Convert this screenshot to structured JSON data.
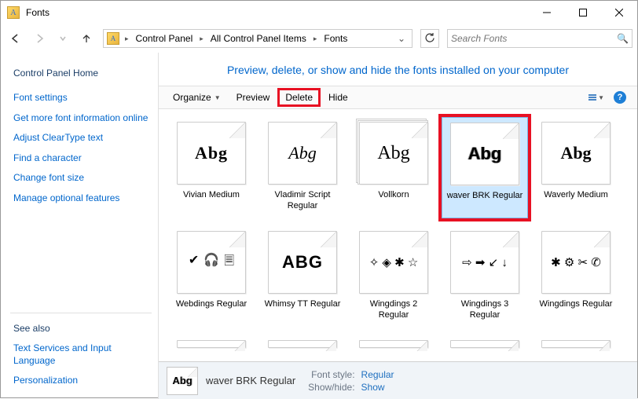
{
  "titlebar": {
    "title": "Fonts"
  },
  "breadcrumbs": [
    "Control Panel",
    "All Control Panel Items",
    "Fonts"
  ],
  "search": {
    "placeholder": "Search Fonts"
  },
  "sidebar": {
    "header": "Control Panel Home",
    "links": [
      "Font settings",
      "Get more font information online",
      "Adjust ClearType text",
      "Find a character",
      "Change font size",
      "Manage optional features"
    ],
    "seealso_header": "See also",
    "seealso": [
      "Text Services and Input Language",
      "Personalization"
    ]
  },
  "content_header": "Preview, delete, or show and hide the fonts installed on your computer",
  "toolbar": {
    "organize": "Organize",
    "preview": "Preview",
    "delete": "Delete",
    "hide": "Hide"
  },
  "fonts": [
    {
      "label": "Vivian Medium",
      "sample": "Abg",
      "style": "font-family:serif;font-weight:900;letter-spacing:1px;",
      "stack": false,
      "selected": false,
      "highlighted": false
    },
    {
      "label": "Vladimir Script Regular",
      "sample": "Abg",
      "style": "font-family:cursive;font-style:italic;",
      "stack": false,
      "selected": false,
      "highlighted": false
    },
    {
      "label": "Vollkorn",
      "sample": "Abg",
      "style": "font-family:Georgia,serif;font-size:24px;",
      "stack": true,
      "selected": false,
      "highlighted": false
    },
    {
      "label": "waver BRK Regular",
      "sample": "Abg",
      "style": "font-family:sans-serif;font-weight:700;text-shadow:1px 0 #999,-1px 0 #999;",
      "stack": false,
      "selected": true,
      "highlighted": true
    },
    {
      "label": "Waverly Medium",
      "sample": "Abg",
      "style": "font-family:serif;font-weight:900;",
      "stack": false,
      "selected": false,
      "highlighted": false
    },
    {
      "label": "Webdings Regular",
      "sample": "",
      "glyph": "webdings",
      "stack": false,
      "selected": false,
      "highlighted": false
    },
    {
      "label": "Whimsy TT Regular",
      "sample": "ABG",
      "style": "font-family:Arial Black,sans-serif;font-weight:900;letter-spacing:1px;",
      "stack": false,
      "selected": false,
      "highlighted": false
    },
    {
      "label": "Wingdings 2 Regular",
      "sample": "",
      "glyph": "wing2",
      "stack": false,
      "selected": false,
      "highlighted": false
    },
    {
      "label": "Wingdings 3 Regular",
      "sample": "",
      "glyph": "wing3",
      "stack": false,
      "selected": false,
      "highlighted": false
    },
    {
      "label": "Wingdings Regular",
      "sample": "",
      "glyph": "wing",
      "stack": false,
      "selected": false,
      "highlighted": false
    }
  ],
  "details": {
    "name": "waver BRK Regular",
    "rows": [
      {
        "label": "Font style:",
        "value": "Regular"
      },
      {
        "label": "Show/hide:",
        "value": "Show"
      }
    ],
    "icon_sample": "Abg"
  }
}
